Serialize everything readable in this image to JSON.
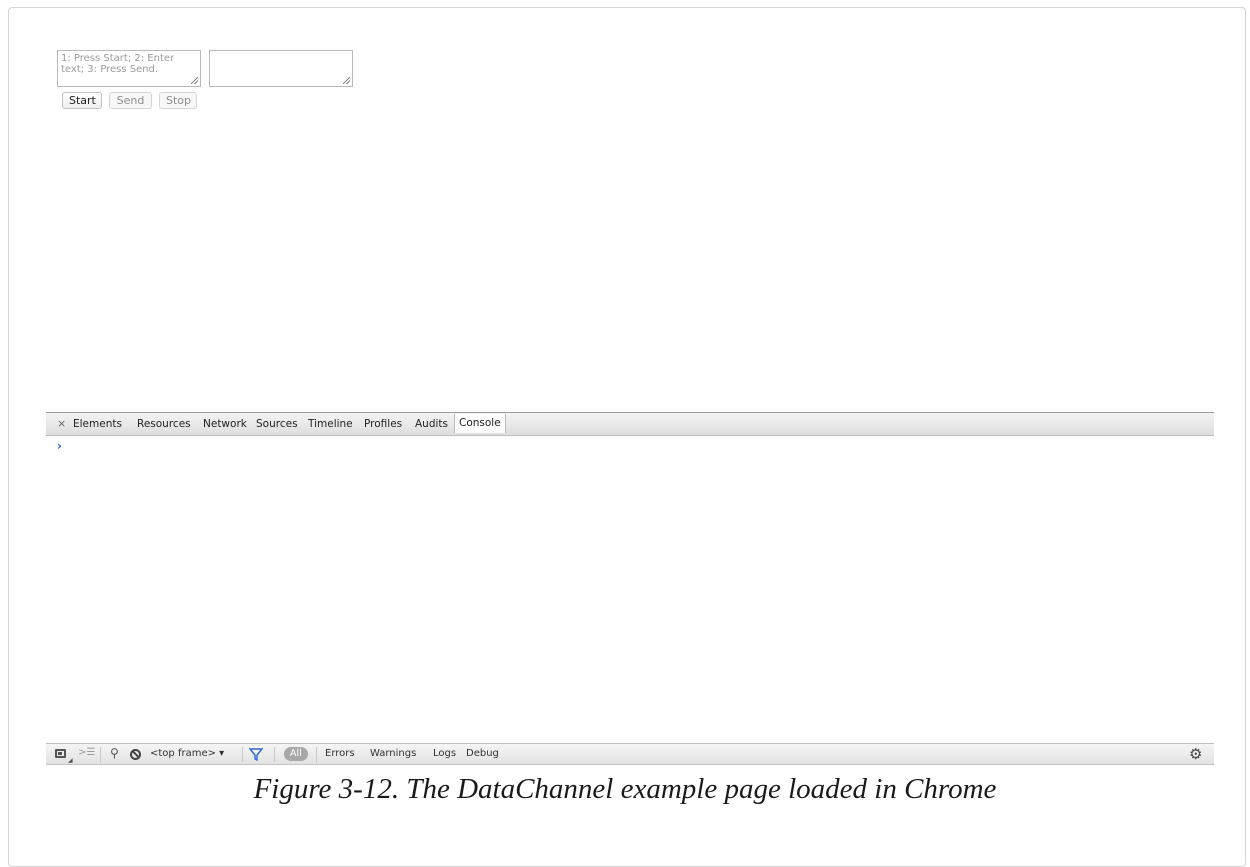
{
  "page": {
    "send_textarea": {
      "placeholder": "1: Press Start; 2: Enter text; 3: Press Send.",
      "value": ""
    },
    "receive_textarea": {
      "value": ""
    },
    "buttons": {
      "start": "Start",
      "send": "Send",
      "stop": "Stop"
    }
  },
  "devtools": {
    "close": "×",
    "tabs": [
      "Elements",
      "Resources",
      "Network",
      "Sources",
      "Timeline",
      "Profiles",
      "Audits",
      "Console"
    ],
    "active_tab": "Console",
    "prompt": "›",
    "status_bar": {
      "frame_selector": "<top frame> ▾",
      "all_label": "All",
      "filters": [
        "Errors",
        "Warnings",
        "Logs",
        "Debug"
      ]
    },
    "icons": [
      "dock-icon",
      "drawer-icon",
      "search-icon",
      "clear-console-icon",
      "filter-icon",
      "gear-icon"
    ],
    "accent_color": "#2a67d1"
  },
  "caption": "Figure 3-12. The DataChannel example page loaded in Chrome"
}
